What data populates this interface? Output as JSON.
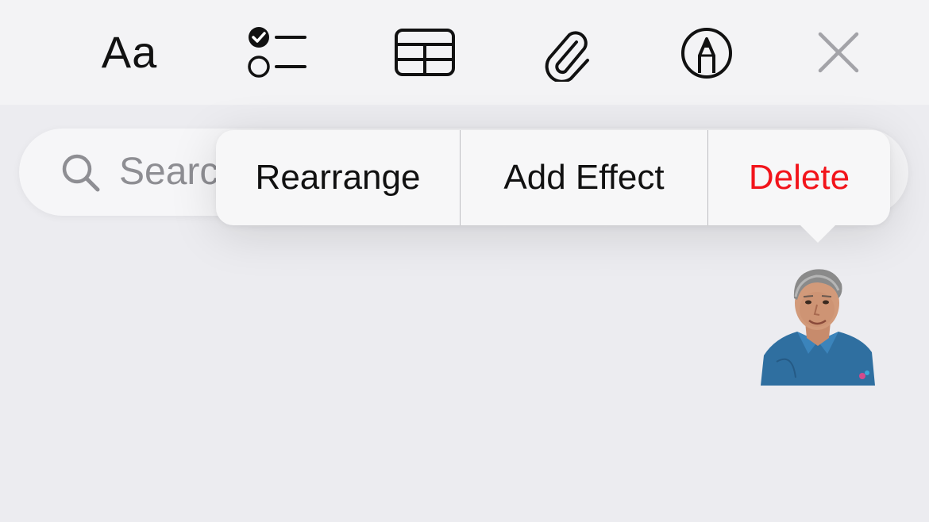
{
  "toolbar": {
    "items": [
      {
        "name": "format",
        "label": "Aa",
        "icon": "text-format-icon"
      },
      {
        "name": "checklist",
        "icon": "checklist-icon"
      },
      {
        "name": "table",
        "icon": "table-icon"
      },
      {
        "name": "attachment",
        "icon": "paperclip-icon"
      },
      {
        "name": "markup",
        "icon": "markup-pen-icon"
      },
      {
        "name": "close",
        "icon": "close-icon"
      }
    ]
  },
  "search": {
    "placeholder": "Search",
    "icon": "search-icon"
  },
  "context_menu": {
    "items": [
      {
        "label": "Rearrange"
      },
      {
        "label": "Add Effect"
      },
      {
        "label": "Delete",
        "destructive": true
      }
    ],
    "destructive_color": "#f2141b"
  },
  "sticker": {
    "kind": "person-photo-sticker"
  }
}
